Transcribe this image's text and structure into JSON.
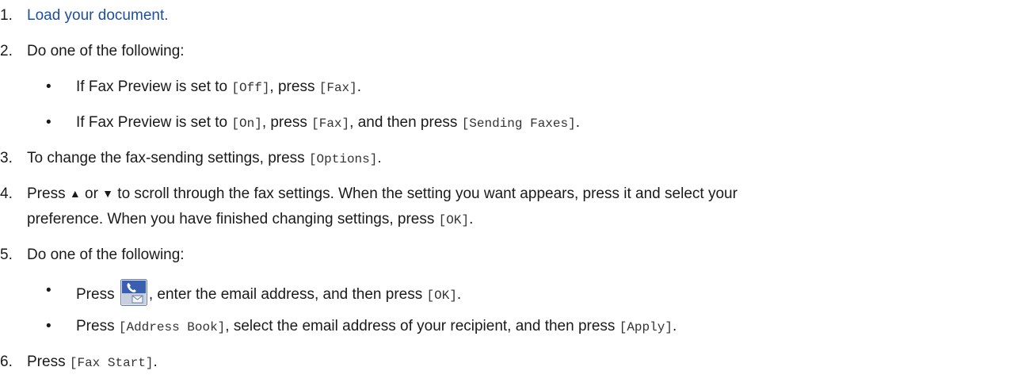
{
  "steps": {
    "s1": {
      "num": "1.",
      "link": "Load your document."
    },
    "s2": {
      "num": "2.",
      "text": "Do one of the following:"
    },
    "s2a": {
      "bullet": "•",
      "pre": "If Fax Preview is set to ",
      "c1": "[Off]",
      "mid": ", press ",
      "c2": "[Fax]",
      "post": "."
    },
    "s2b": {
      "bullet": "•",
      "pre": "If Fax Preview is set to ",
      "c1": "[On]",
      "mid": ", press ",
      "c2": "[Fax]",
      "mid2": ", and then press ",
      "c3": "[Sending Faxes]",
      "post": "."
    },
    "s3": {
      "num": "3.",
      "pre": "To change the fax-sending settings, press ",
      "c1": "[Options]",
      "post": "."
    },
    "s4": {
      "num": "4.",
      "pre": "Press ",
      "up": "▲",
      "or": " or ",
      "down": "▼",
      "line1": " to scroll through the fax settings. When the setting you want appears, press it and select your",
      "line2": "preference. When you have finished changing settings, press ",
      "c1": "[OK]",
      "post": "."
    },
    "s5": {
      "num": "5.",
      "text": "Do one of the following:"
    },
    "s5a": {
      "bullet": "•",
      "pre": "Press ",
      "mid": ", enter the email address, and then press ",
      "c1": "[OK]",
      "post": "."
    },
    "s5b": {
      "bullet": "•",
      "pre": "Press ",
      "c1": "[Address Book]",
      "mid": ", select the email address of your recipient, and then press ",
      "c2": "[Apply]",
      "post": "."
    },
    "s6": {
      "num": "6.",
      "pre": "Press ",
      "c1": "[Fax Start]",
      "post": "."
    }
  },
  "icons": {
    "fax_email": "fax-email-icon",
    "colors": {
      "top": "#3a5fb0",
      "bottom": "#a9b4c8",
      "frame": "#6d7fa6"
    }
  },
  "colors": {
    "link": "#1c4fa0",
    "text": "#1a1a1a",
    "code": "#333333"
  }
}
